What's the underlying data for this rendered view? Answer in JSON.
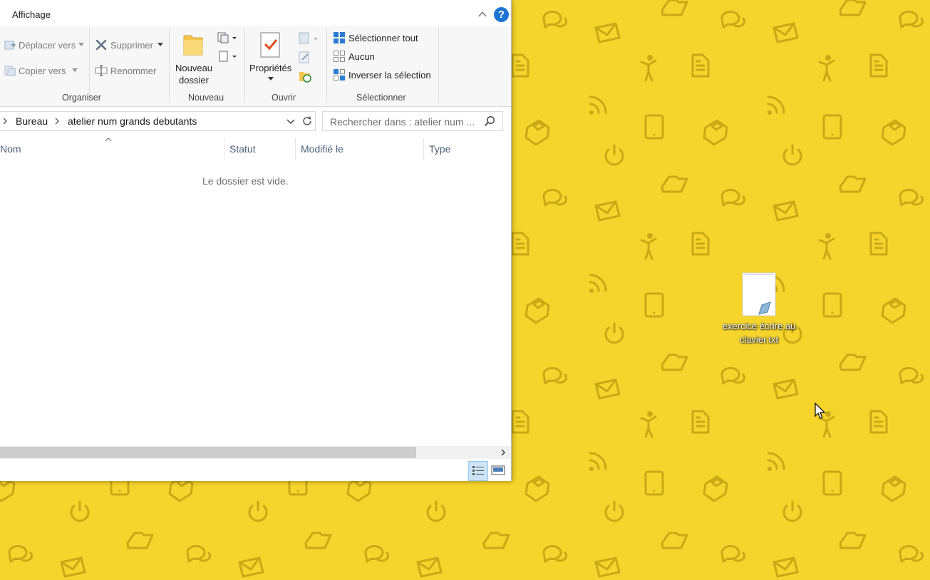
{
  "window": {
    "tab": "Affichage",
    "help_label": "?"
  },
  "ribbon": {
    "organiser": {
      "label": "Organiser",
      "move_to": "Déplacer vers",
      "copy_to": "Copier vers",
      "delete": "Supprimer",
      "rename": "Renommer"
    },
    "nouveau": {
      "label": "Nouveau",
      "new_folder_line1": "Nouveau",
      "new_folder_line2": "dossier"
    },
    "ouvrir": {
      "label": "Ouvrir",
      "properties": "Propriétés"
    },
    "selectionner": {
      "label": "Sélectionner",
      "select_all": "Sélectionner tout",
      "none": "Aucun",
      "invert": "Inverser la sélection"
    }
  },
  "address": {
    "crumbs": [
      "Bureau",
      "atelier num grands debutants"
    ],
    "search_placeholder": "Rechercher dans : atelier num ..."
  },
  "columns": {
    "name": "Nom",
    "status": "Statut",
    "modified": "Modifié le",
    "type": "Type"
  },
  "content": {
    "empty_message": "Le dossier est vide."
  },
  "desktop": {
    "file_label": "exercice écrire au clavier.txt",
    "wallpaper_color": "#f5d42c"
  }
}
